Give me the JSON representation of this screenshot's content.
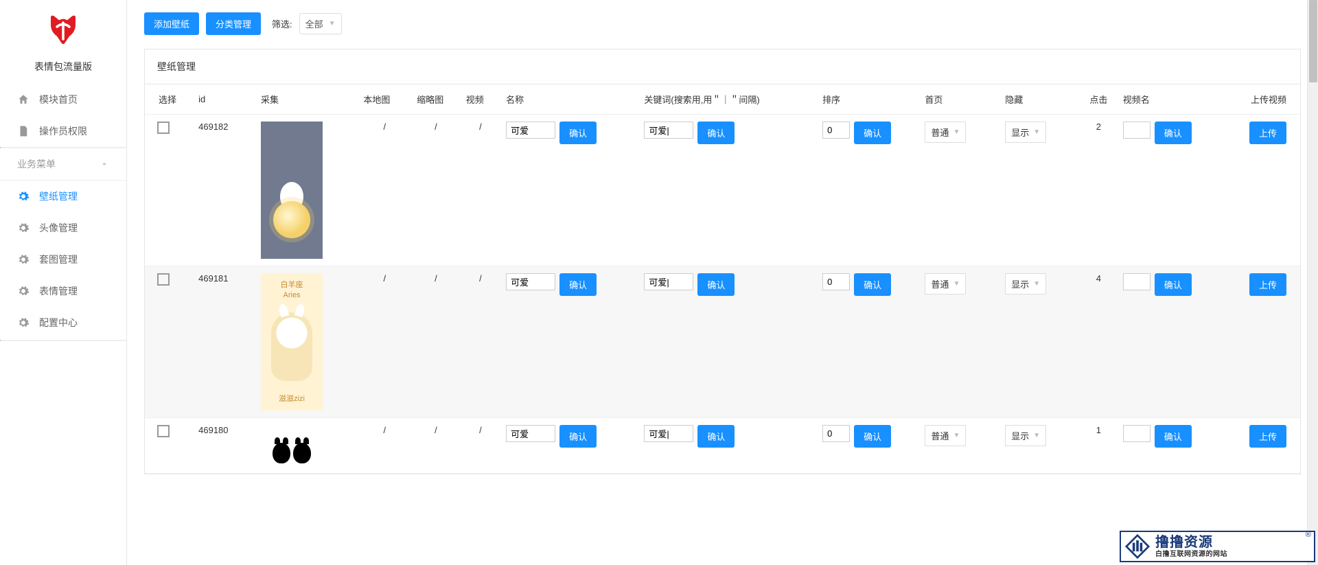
{
  "app": {
    "name": "表情包流量版"
  },
  "sidebar": {
    "top_items": [
      {
        "label": "模块首页",
        "icon": "home"
      },
      {
        "label": "操作员权限",
        "icon": "document"
      }
    ],
    "group_header": "业务菜单",
    "items": [
      {
        "label": "壁纸管理",
        "icon": "gear",
        "active": true
      },
      {
        "label": "头像管理",
        "icon": "gear"
      },
      {
        "label": "套图管理",
        "icon": "gear"
      },
      {
        "label": "表情管理",
        "icon": "gear"
      },
      {
        "label": "配置中心",
        "icon": "gear"
      }
    ]
  },
  "toolbar": {
    "add_wallpaper": "添加壁纸",
    "category_mgmt": "分类管理",
    "filter_label": "筛选:",
    "filter_value": "全部"
  },
  "panel": {
    "title": "壁纸管理"
  },
  "columns": {
    "select": "选择",
    "id": "id",
    "collect": "采集",
    "local": "本地图",
    "thumbnail": "缩略图",
    "video": "视频",
    "name": "名称",
    "keywords": "关键词(搜索用,用＂｜＂间隔)",
    "sort": "排序",
    "homepage": "首页",
    "hidden": "隐藏",
    "clicks": "点击",
    "videoname": "视频名",
    "upload": "上传视频"
  },
  "labels": {
    "confirm": "确认",
    "upload": "上传",
    "homepage_normal": "普通",
    "hidden_show": "显示"
  },
  "rows": [
    {
      "id": "469182",
      "local": "/",
      "thumbnail": "/",
      "video": "/",
      "name": "可爱",
      "keywords": "可爱|",
      "sort": "0",
      "clicks": "2",
      "videoname": "",
      "thumb_style": "thumb1",
      "thumb_text_top": "",
      "thumb_text_bottom": ""
    },
    {
      "id": "469181",
      "local": "/",
      "thumbnail": "/",
      "video": "/",
      "name": "可爱",
      "keywords": "可爱|",
      "sort": "0",
      "clicks": "4",
      "videoname": "",
      "thumb_style": "thumb2",
      "thumb_text_top": "白羊座\nAries",
      "thumb_text_bottom": "滋滋zizi"
    },
    {
      "id": "469180",
      "local": "/",
      "thumbnail": "/",
      "video": "/",
      "name": "可爱",
      "keywords": "可爱|",
      "sort": "0",
      "clicks": "1",
      "videoname": "",
      "thumb_style": "thumb3",
      "thumb_text_top": "",
      "thumb_text_bottom": ""
    }
  ],
  "watermark": {
    "title": "撸撸资源",
    "subtitle": "白撸互联网资源的网站"
  }
}
